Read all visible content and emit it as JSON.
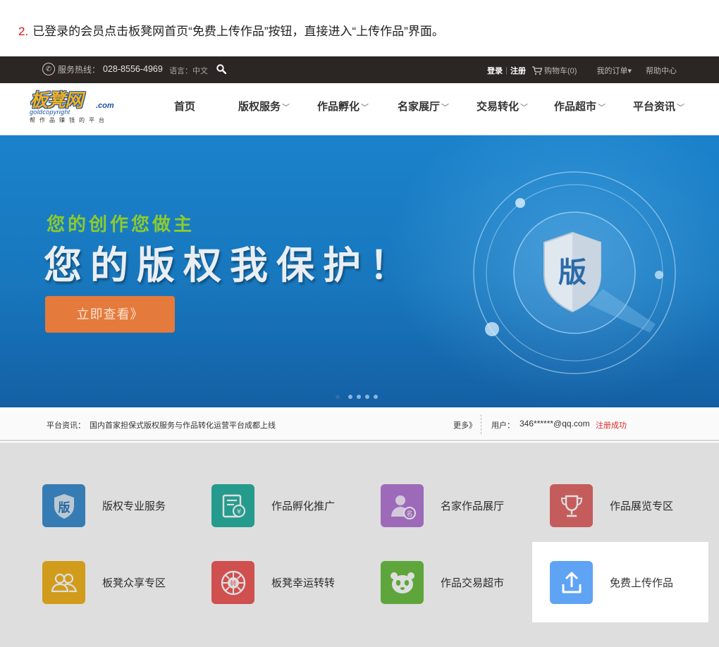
{
  "instruction": {
    "step_number": "2.",
    "text": "已登录的会员点击板凳网首页“免费上传作品”按钮，直接进入“上传作品”界面。"
  },
  "topbar": {
    "hotline_label": "服务热线：",
    "hotline_number": "028-8556-4969",
    "language": "语言：中文",
    "login": "登录",
    "register": "注册",
    "cart": "购物车(0)",
    "orders": "我的订单▾",
    "help": "帮助中心"
  },
  "logo": {
    "main": "板凳网",
    "dotcom": ".com",
    "sub_en": "goldcopyright",
    "slogan": "帮作品赚钱的平台"
  },
  "nav": {
    "items": [
      {
        "label": "首页",
        "has_caret": false
      },
      {
        "label": "版权服务",
        "has_caret": true
      },
      {
        "label": "作品孵化",
        "has_caret": true
      },
      {
        "label": "名家展厅",
        "has_caret": true
      },
      {
        "label": "交易转化",
        "has_caret": true
      },
      {
        "label": "作品超市",
        "has_caret": true
      },
      {
        "label": "平台资讯",
        "has_caret": true
      }
    ]
  },
  "banner": {
    "slogan_small": "您的创作您做主",
    "slogan_big": "您的版权我保护！",
    "cta": "立即查看》",
    "emblem_char": "版",
    "slide_count": 5,
    "active_slide": 1
  },
  "newsbar": {
    "label": "平台资讯：",
    "headline": "国内首家担保式版权服务与作品转化运营平台成都上线",
    "more": "更多》",
    "user_label": "用户：",
    "user_value": "346******@qq.com",
    "user_status": "注册成功"
  },
  "services": {
    "items": [
      {
        "label": "版权专业服务",
        "icon": "shield-ban-icon",
        "color": "#3e8fcf"
      },
      {
        "label": "作品孵化推广",
        "icon": "certificate-icon",
        "color": "#2bb3a3"
      },
      {
        "label": "名家作品展厅",
        "icon": "master-avatar-icon",
        "color": "#b57ad6"
      },
      {
        "label": "作品展览专区",
        "icon": "trophy-icon",
        "color": "#e36a6a"
      },
      {
        "label": "板凳众享专区",
        "icon": "group-users-icon",
        "color": "#f0b21f"
      },
      {
        "label": "板凳幸运转转",
        "icon": "lucky-wheel-icon",
        "color": "#ef5b5b"
      },
      {
        "label": "作品交易超市",
        "icon": "panda-icon",
        "color": "#6cbf45"
      },
      {
        "label": "免费上传作品",
        "icon": "upload-icon",
        "color": "#5fa3f5"
      }
    ]
  }
}
